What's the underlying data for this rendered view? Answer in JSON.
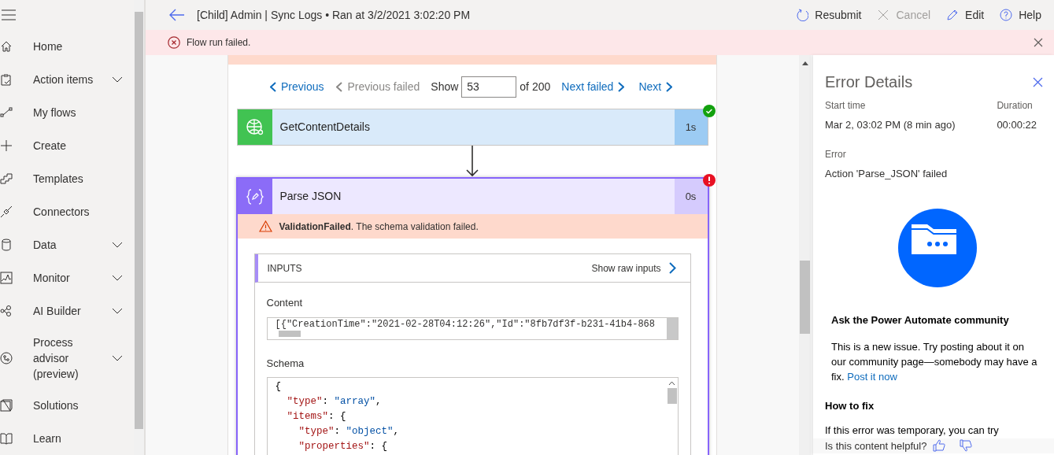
{
  "sidebar": {
    "items": [
      {
        "label": "Home",
        "expandable": false
      },
      {
        "label": "Action items",
        "expandable": true
      },
      {
        "label": "My flows",
        "expandable": false
      },
      {
        "label": "Create",
        "expandable": false
      },
      {
        "label": "Templates",
        "expandable": false
      },
      {
        "label": "Connectors",
        "expandable": false
      },
      {
        "label": "Data",
        "expandable": true
      },
      {
        "label": "Monitor",
        "expandable": true
      },
      {
        "label": "AI Builder",
        "expandable": true
      },
      {
        "label": "Process advisor (preview)",
        "expandable": true
      },
      {
        "label": "Solutions",
        "expandable": false
      },
      {
        "label": "Learn",
        "expandable": false
      }
    ]
  },
  "header": {
    "title": "[Child] Admin | Sync Logs • Ran at 3/2/2021 3:02:20 PM",
    "actions": [
      {
        "label": "Resubmit",
        "disabled": false
      },
      {
        "label": "Cancel",
        "disabled": true
      },
      {
        "label": "Edit",
        "disabled": false
      },
      {
        "label": "Help",
        "disabled": false
      }
    ]
  },
  "banner": {
    "message": "Flow run failed."
  },
  "run_nav": {
    "previous": {
      "label": "Previous",
      "disabled": false
    },
    "previous_failed": {
      "label": "Previous failed",
      "disabled": true
    },
    "show_label": "Show",
    "run_number": "53",
    "total": "of 200",
    "next_failed": {
      "label": "Next failed",
      "disabled": false
    },
    "next": {
      "label": "Next",
      "disabled": false
    }
  },
  "actions": [
    {
      "name": "GetContentDetails",
      "duration": "1s",
      "failed": false
    },
    {
      "name": "Parse JSON",
      "duration": "0s",
      "failed": true,
      "error": "**ValidationFailed**. The schema validation failed.",
      "inputs": {
        "heading": "INPUTS",
        "raw_link": "Show raw inputs",
        "content_label": "Content",
        "content_value": "[{\"CreationTime\":\"2021-02-28T04:12:26\",\"Id\":\"8fb7df3f-b231-41b4-868",
        "schema_label": "Schema",
        "schema_lines": [
          [
            {
              "text": "{",
              "kind": "punct"
            }
          ],
          [
            {
              "text": "  \"type\"",
              "kind": "key"
            },
            {
              "text": ": ",
              "kind": "punct"
            },
            {
              "text": "\"array\"",
              "kind": "string"
            },
            {
              "text": ",",
              "kind": "punct"
            }
          ],
          [
            {
              "text": "  \"items\"",
              "kind": "key"
            },
            {
              "text": ": {",
              "kind": "punct"
            }
          ],
          [
            {
              "text": "    \"type\"",
              "kind": "key"
            },
            {
              "text": ": ",
              "kind": "punct"
            },
            {
              "text": "\"object\"",
              "kind": "string"
            },
            {
              "text": ",",
              "kind": "punct"
            }
          ],
          [
            {
              "text": "    \"properties\"",
              "kind": "key"
            },
            {
              "text": ": {",
              "kind": "punct"
            }
          ]
        ]
      }
    }
  ],
  "error_panel": {
    "title": "Error Details",
    "start_label": "Start time",
    "start_value": "Mar 2, 03:02 PM (8 min ago)",
    "duration_label": "Duration",
    "duration_value": "00:00:22",
    "error_label": "Error",
    "error_value": "Action 'Parse_JSON' failed",
    "community_heading": "Ask the Power Automate community",
    "community_text": "This is a new issue. Try posting about it on our community page—somebody may have a fix.",
    "community_link": "Post it now",
    "fix_heading": "How to fix",
    "fix_text": "If this error was temporary, you can try",
    "feedback_question": "Is this content helpful?"
  }
}
